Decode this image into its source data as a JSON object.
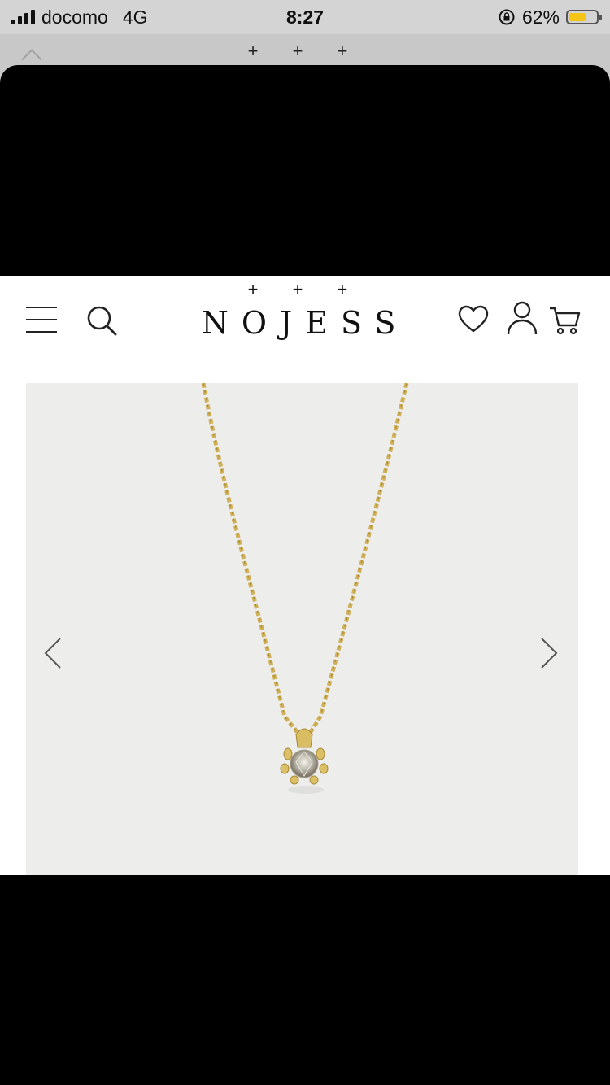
{
  "status_bar": {
    "carrier": "docomo",
    "network": "4G",
    "time": "8:27",
    "battery": "62%",
    "battery_level": 0.62,
    "battery_color": "#f5c518"
  },
  "back_sheet": {
    "brand_mark": "+ + +"
  },
  "header": {
    "brand_mark": "+ + +",
    "logo": "NOJESS",
    "icons": [
      "menu-icon",
      "search-icon",
      "heart-icon",
      "user-icon",
      "cart-icon"
    ]
  },
  "product_carousel": {
    "image": "gold-necklace-diamond-pendant",
    "prev_icon": "chevron-left-icon",
    "next_icon": "chevron-right-icon"
  }
}
